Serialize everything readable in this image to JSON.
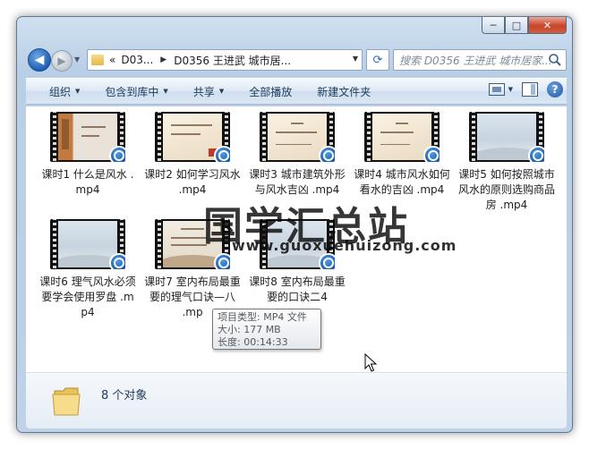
{
  "window": {
    "buttons": {
      "minimize": "─",
      "maximize": "□",
      "close": "✕"
    }
  },
  "nav": {
    "back_icon": "arrow-left-icon",
    "forward_icon": "arrow-right-icon",
    "address": {
      "overflow": "«",
      "crumbs": [
        "D03...",
        "D0356 王进武 城市居..."
      ]
    },
    "search_placeholder": "搜索 D0356 王进武 城市居家..."
  },
  "toolbar": {
    "organize": "组织",
    "include_in_library": "包含到库中",
    "share": "共享",
    "play_all": "全部播放",
    "new_folder": "新建文件夹",
    "help": "?"
  },
  "files": [
    {
      "name": "课时1 什么是风水 .mp4"
    },
    {
      "name": "课时2 如何学习风水 .mp4"
    },
    {
      "name": "课时3 城市建筑外形与风水吉凶 .mp4"
    },
    {
      "name": "课时4 城市风水如何看水的吉凶 .mp4"
    },
    {
      "name": "课时5 如何按照城市风水的原则选购商品房 .mp4"
    },
    {
      "name": "课时6 理气风水必须要学会使用罗盘 .mp4"
    },
    {
      "name": "课时7 室内布局最重要的理气口诀—八"
    },
    {
      "name": "课时8 室内布局最重要的口诀二"
    }
  ],
  "file7_tail": ".mp",
  "file8_tail": "4",
  "watermark": {
    "title": "国学汇总站",
    "url": "www.guoxuehuizong.com"
  },
  "tooltip": {
    "type": "项目类型: MP4 文件",
    "size": "大小: 177 MB",
    "length": "长度: 00:14:33"
  },
  "details": {
    "count": "8 个对象"
  }
}
